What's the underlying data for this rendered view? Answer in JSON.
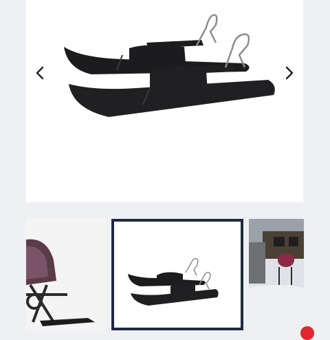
{
  "carousel": {
    "prev_icon": "chevron-left-icon",
    "next_icon": "chevron-right-icon",
    "selected_index": 1
  },
  "thumbnails": [
    {
      "icon": "stroller-with-skis-image"
    },
    {
      "icon": "stroller-skis-image"
    },
    {
      "icon": "stroller-in-snow-image"
    }
  ],
  "colors": {
    "selected_border": "#1e2a44",
    "badge": "#e0262e",
    "ski": "#1c1c1e"
  }
}
